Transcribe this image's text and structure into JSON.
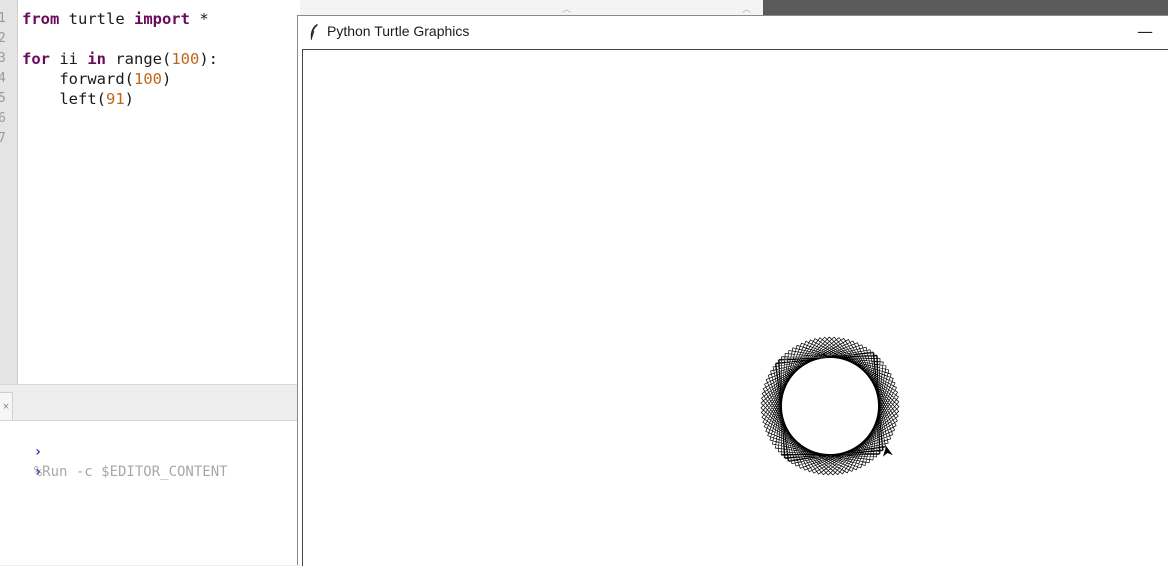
{
  "editor": {
    "line_numbers": [
      "1",
      "2",
      "3",
      "4",
      "5",
      "6",
      "7"
    ],
    "lines": [
      [
        {
          "t": "from",
          "c": "kw"
        },
        {
          "t": " turtle ",
          "c": "fn"
        },
        {
          "t": "import",
          "c": "kw"
        },
        {
          "t": " *",
          "c": "fn"
        }
      ],
      [],
      [
        {
          "t": "for",
          "c": "kw"
        },
        {
          "t": " ii ",
          "c": "fn"
        },
        {
          "t": "in",
          "c": "kw"
        },
        {
          "t": " range(",
          "c": "fn"
        },
        {
          "t": "100",
          "c": "num"
        },
        {
          "t": "):",
          "c": "fn"
        }
      ],
      [
        {
          "t": "    forward(",
          "c": "fn"
        },
        {
          "t": "100",
          "c": "num"
        },
        {
          "t": ")",
          "c": "fn"
        }
      ],
      [
        {
          "t": "    left(",
          "c": "fn"
        },
        {
          "t": "91",
          "c": "num"
        },
        {
          "t": ")",
          "c": "fn"
        }
      ],
      [],
      []
    ]
  },
  "shell": {
    "command_line": "%Run -c $EDITOR_CONTENT",
    "prompt_glyph": "›"
  },
  "turtle_window": {
    "title": "Python Turtle Graphics",
    "minimize_glyph": "—",
    "drawing": {
      "iterations": 100,
      "forward_distance": 100,
      "left_angle_deg": 91,
      "pen_color": "#000000"
    }
  }
}
